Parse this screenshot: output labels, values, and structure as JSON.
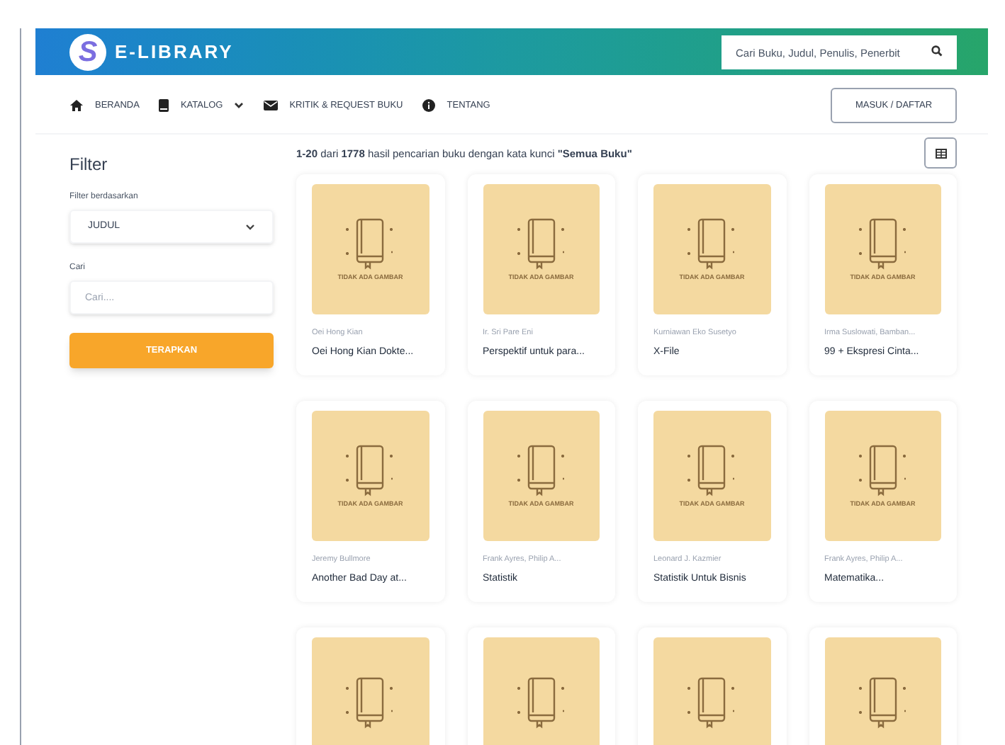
{
  "header": {
    "logo_letter": "S",
    "title": "E-LIBRARY",
    "search": {
      "placeholder": "Cari Buku, Judul, Penulis, Penerbit"
    }
  },
  "nav": [
    {
      "kind": "home",
      "label": "BERANDA",
      "dropdown": false
    },
    {
      "kind": "book",
      "label": "KATALOG",
      "dropdown": true
    },
    {
      "kind": "mail",
      "label": "KRITIK & REQUEST BUKU",
      "dropdown": false
    },
    {
      "kind": "info",
      "label": "TENTANG",
      "dropdown": false
    }
  ],
  "login_button": "MASUK / DAFTAR",
  "filter": {
    "title": "Filter",
    "by_label": "Filter berdasarkan",
    "by_value": "JUDUL",
    "search_label": "Cari",
    "search_placeholder": "Cari....",
    "apply_button": "TERAPKAN"
  },
  "results_summary": "**1-20** dari **1778** hasil pencarian buku dengan kata kunci **\"Semua Buku\"**",
  "books": [
    {
      "kind": "full",
      "cover_label": "TIDAK ADA GAMBAR",
      "author": "Oei Hong Kian",
      "title": "Oei Hong Kian Dokte..."
    },
    {
      "kind": "full",
      "cover_label": "TIDAK ADA GAMBAR",
      "author": "Ir. Sri Pare Eni",
      "title": "Perspektif untuk para..."
    },
    {
      "kind": "full",
      "cover_label": "TIDAK ADA GAMBAR",
      "author": "Kurniawan Eko Susetyo",
      "title": "X-File"
    },
    {
      "kind": "full",
      "cover_label": "TIDAK ADA GAMBAR",
      "author": "Irma Suslowati, Bamban...",
      "title": "99 + Ekspresi Cinta..."
    },
    {
      "kind": "full",
      "cover_label": "TIDAK ADA GAMBAR",
      "author": "Jeremy Bullmore",
      "title": "Another Bad Day at..."
    },
    {
      "kind": "full",
      "cover_label": "TIDAK ADA GAMBAR",
      "author": "Frank Ayres, Philip A...",
      "title": "Statistik"
    },
    {
      "kind": "full",
      "cover_label": "TIDAK ADA GAMBAR",
      "author": "Leonard J. Kazmier",
      "title": "Statistik Untuk Bisnis"
    },
    {
      "kind": "full",
      "cover_label": "TIDAK ADA GAMBAR",
      "author": "Frank Ayres, Philip A...",
      "title": "Matematika..."
    },
    {
      "kind": "cut_off"
    },
    {
      "kind": "cut_off"
    },
    {
      "kind": "cut_off"
    },
    {
      "kind": "cut_off"
    }
  ]
}
